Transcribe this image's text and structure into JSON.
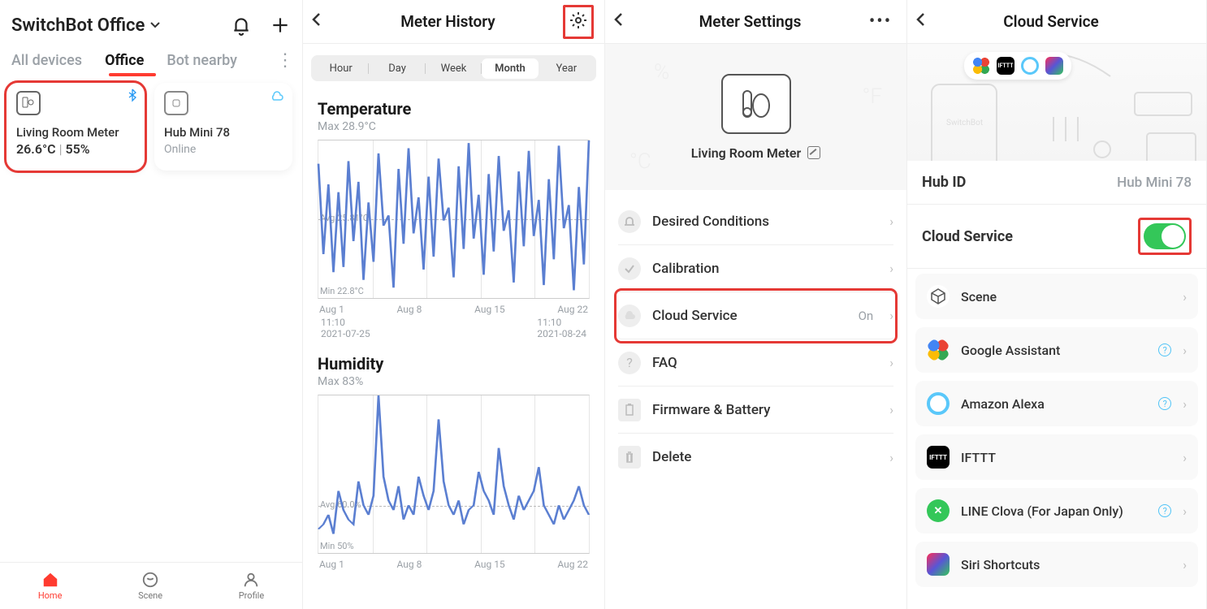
{
  "pane1": {
    "location": "SwitchBot Office",
    "tabs": [
      "All devices",
      "Office",
      "Bot nearby"
    ],
    "active_tab_index": 1,
    "cards": [
      {
        "name": "Living Room Meter",
        "temp": "26.6°C",
        "hum": "55%",
        "highlight": true,
        "bluetooth": true
      },
      {
        "name": "Hub Mini 78",
        "status": "Online",
        "cloud": true
      }
    ],
    "bottom_nav": [
      "Home",
      "Scene",
      "Profile"
    ],
    "bottom_active": 0
  },
  "pane2": {
    "title": "Meter History",
    "segments": [
      "Hour",
      "Day",
      "Week",
      "Month",
      "Year"
    ],
    "active_segment": 3,
    "temp": {
      "title": "Temperature",
      "max": "Max 28.9°C",
      "avg": "Avg 25.81°C",
      "min": "Min 22.8°C"
    },
    "hum": {
      "title": "Humidity",
      "max": "Max 83%",
      "avg": "Avg 60.0%",
      "min": "Min 50%"
    },
    "xaxis": [
      "Aug 1",
      "Aug 8",
      "Aug 15",
      "Aug 22"
    ],
    "range_left_time": "11:10",
    "range_left_date": "2021-07-25",
    "range_right_time": "11:10",
    "range_right_date": "2021-08-24"
  },
  "pane3": {
    "title": "Meter Settings",
    "device_name": "Living Room Meter",
    "rows": [
      {
        "label": "Desired Conditions"
      },
      {
        "label": "Calibration"
      },
      {
        "label": "Cloud Service",
        "value": "On",
        "highlight": true
      },
      {
        "label": "FAQ"
      },
      {
        "label": "Firmware & Battery"
      },
      {
        "label": "Delete"
      }
    ]
  },
  "pane4": {
    "title": "Cloud Service",
    "hub_label": "Hub ID",
    "hub_value": "Hub Mini 78",
    "cloud_label": "Cloud Service",
    "cloud_on": true,
    "integrations": [
      "Scene",
      "Google Assistant",
      "Amazon Alexa",
      "IFTTT",
      "LINE Clova (For Japan Only)",
      "Siri Shortcuts"
    ],
    "help_flags": [
      false,
      true,
      true,
      false,
      true,
      false
    ]
  },
  "chart_data": [
    {
      "type": "line",
      "title": "Temperature",
      "ylabel": "°C",
      "xlabel": "",
      "ylim": [
        22.8,
        28.9
      ],
      "categories": [
        "Aug 1",
        "Aug 8",
        "Aug 15",
        "Aug 22"
      ],
      "annotations": {
        "max": "Max 28.9°C",
        "avg": "Avg 25.81°C",
        "min": "Min 22.8°C"
      },
      "series": [
        {
          "name": "Temperature",
          "avg": 25.81,
          "values": [
            28.0,
            24.5,
            27.2,
            23.8,
            26.9,
            24.0,
            28.1,
            25.0,
            27.3,
            23.5,
            26.5,
            24.2,
            28.4,
            25.6,
            26.0,
            23.2,
            27.8,
            24.9,
            28.6,
            25.3,
            26.7,
            23.9,
            27.5,
            24.4,
            28.2,
            25.8,
            26.3,
            23.6,
            27.9,
            24.7,
            28.8,
            25.1,
            26.8,
            23.7,
            27.6,
            24.6,
            28.3,
            25.4,
            26.2,
            23.4,
            27.7,
            24.8,
            28.5,
            25.2,
            26.6,
            23.3,
            27.4,
            24.3,
            28.7,
            25.5,
            26.4,
            23.1,
            27.1,
            24.1,
            28.9
          ]
        }
      ]
    },
    {
      "type": "line",
      "title": "Humidity",
      "ylabel": "%",
      "xlabel": "",
      "ylim": [
        50,
        83
      ],
      "categories": [
        "Aug 1",
        "Aug 8",
        "Aug 15",
        "Aug 22"
      ],
      "annotations": {
        "max": "Max 83%",
        "avg": "Avg 60.0%",
        "min": "Min 50%"
      },
      "series": [
        {
          "name": "Humidity",
          "avg": 60.0,
          "values": [
            55,
            56,
            58,
            54,
            63,
            59,
            57,
            56,
            65,
            60,
            58,
            62,
            83,
            66,
            61,
            59,
            64,
            57,
            60,
            58,
            66,
            62,
            59,
            63,
            78,
            65,
            60,
            58,
            61,
            56,
            59,
            60,
            67,
            63,
            61,
            58,
            72,
            64,
            60,
            57,
            62,
            59,
            61,
            63,
            68,
            60,
            58,
            56,
            60,
            57,
            59,
            61,
            64,
            60,
            58
          ]
        }
      ]
    }
  ]
}
